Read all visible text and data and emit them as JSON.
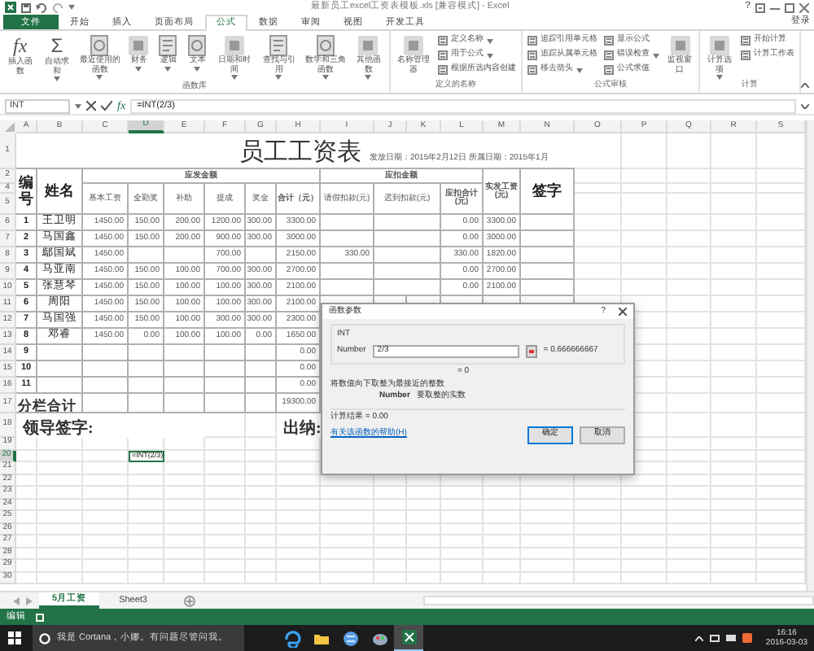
{
  "window": {
    "title": "最新员工excel工资表模板.xls  [兼容模式] - Excel",
    "help": "?"
  },
  "ribbon_tabs": [
    {
      "label": "文件",
      "kind": "file",
      "selected": false
    },
    {
      "label": "开始",
      "kind": "tab",
      "selected": false
    },
    {
      "label": "插入",
      "kind": "tab",
      "selected": false
    },
    {
      "label": "页面布局",
      "kind": "tab",
      "selected": false
    },
    {
      "label": "公式",
      "kind": "tab",
      "selected": true
    },
    {
      "label": "数据",
      "kind": "tab",
      "selected": false
    },
    {
      "label": "审阅",
      "kind": "tab",
      "selected": false
    },
    {
      "label": "视图",
      "kind": "tab",
      "selected": false
    },
    {
      "label": "开发工具",
      "kind": "tab",
      "selected": false
    }
  ],
  "account": "登录",
  "ribbon_groups": [
    {
      "label": "函数库",
      "items": [
        {
          "kind": "large",
          "symbol": "fx",
          "label": "插入函数",
          "dropdown": false
        },
        {
          "kind": "large",
          "symbol": "Σ",
          "label": "自动求和",
          "dropdown": true
        },
        {
          "kind": "large",
          "label": "最近使用的函数",
          "dropdown": true
        },
        {
          "kind": "large",
          "label": "财务",
          "dropdown": true
        },
        {
          "kind": "large",
          "label": "逻辑",
          "dropdown": true
        },
        {
          "kind": "large",
          "label": "文本",
          "dropdown": true
        },
        {
          "kind": "large",
          "label": "日期和时间",
          "dropdown": true
        },
        {
          "kind": "large",
          "label": "查找与引用",
          "dropdown": true
        },
        {
          "kind": "large",
          "label": "数学和三角函数",
          "dropdown": true
        },
        {
          "kind": "large",
          "label": "其他函数",
          "dropdown": true
        }
      ]
    },
    {
      "label": "定义的名称",
      "items": [
        {
          "kind": "large",
          "label": "名称管理器",
          "dropdown": false
        },
        {
          "kind": "small",
          "label": "定义名称",
          "dropdown": true
        },
        {
          "kind": "small",
          "label": "用于公式",
          "dropdown": true
        },
        {
          "kind": "small",
          "label": "根据所选内容创建",
          "dropdown": false
        }
      ]
    },
    {
      "label": "公式审核",
      "items": [
        {
          "kind": "small",
          "label": "追踪引用单元格",
          "dropdown": false
        },
        {
          "kind": "small",
          "label": "追踪从属单元格",
          "dropdown": false
        },
        {
          "kind": "small",
          "label": "移去箭头",
          "dropdown": true
        },
        {
          "kind": "small",
          "label": "显示公式",
          "dropdown": false
        },
        {
          "kind": "small",
          "label": "错误检查",
          "dropdown": true
        },
        {
          "kind": "small",
          "label": "公式求值",
          "dropdown": false
        },
        {
          "kind": "large",
          "label": "监视窗口",
          "dropdown": false
        }
      ]
    },
    {
      "label": "计算",
      "items": [
        {
          "kind": "large",
          "label": "计算选项",
          "dropdown": true
        },
        {
          "kind": "small",
          "label": "开始计算",
          "dropdown": false
        },
        {
          "kind": "small",
          "label": "计算工作表",
          "dropdown": false
        }
      ]
    }
  ],
  "formula_bar": {
    "name_box": "INT",
    "fx": "fx",
    "formula": "=INT(2/3)"
  },
  "columns": [
    {
      "label": "A",
      "selected": false
    },
    {
      "label": "B",
      "selected": false
    },
    {
      "label": "C",
      "selected": false
    },
    {
      "label": "D",
      "selected": true
    },
    {
      "label": "E",
      "selected": false
    },
    {
      "label": "F",
      "selected": false
    },
    {
      "label": "G",
      "selected": false
    },
    {
      "label": "H",
      "selected": false
    },
    {
      "label": "I",
      "selected": false
    },
    {
      "label": "J",
      "selected": false
    },
    {
      "label": "K",
      "selected": false
    },
    {
      "label": "L",
      "selected": false
    },
    {
      "label": "M",
      "selected": false
    },
    {
      "label": "N",
      "selected": false
    },
    {
      "label": "O",
      "selected": false
    },
    {
      "label": "P",
      "selected": false
    },
    {
      "label": "Q",
      "selected": false
    },
    {
      "label": "R",
      "selected": false
    },
    {
      "label": "S",
      "selected": false
    }
  ],
  "rows": [
    {
      "label": "1",
      "selected": false
    },
    {
      "label": "2",
      "selected": false
    },
    {
      "label": "4",
      "selected": false
    },
    {
      "label": "5",
      "selected": false
    },
    {
      "label": "6",
      "selected": false
    },
    {
      "label": "7",
      "selected": false
    },
    {
      "label": "8",
      "selected": false
    },
    {
      "label": "9",
      "selected": false
    },
    {
      "label": "10",
      "selected": false
    },
    {
      "label": "11",
      "selected": false
    },
    {
      "label": "12",
      "selected": false
    },
    {
      "label": "13",
      "selected": false
    },
    {
      "label": "14",
      "selected": false
    },
    {
      "label": "15",
      "selected": false
    },
    {
      "label": "16",
      "selected": false
    },
    {
      "label": "17",
      "selected": false
    },
    {
      "label": "18",
      "selected": false
    },
    {
      "label": "19",
      "selected": false
    },
    {
      "label": "20",
      "selected": true
    },
    {
      "label": "21",
      "selected": false
    },
    {
      "label": "22",
      "selected": false
    },
    {
      "label": "23",
      "selected": false
    },
    {
      "label": "24",
      "selected": false
    },
    {
      "label": "25",
      "selected": false
    },
    {
      "label": "26",
      "selected": false
    },
    {
      "label": "27",
      "selected": false
    },
    {
      "label": "28",
      "selected": false
    },
    {
      "label": "29",
      "selected": false
    },
    {
      "label": "30",
      "selected": false
    }
  ],
  "sheet": {
    "title": "员工工资表",
    "date_line": "发放日期：2015年2月12日 所属日期：2015年1月",
    "headers": {
      "number": "编号",
      "name": "姓名",
      "earnings_group": "应发金额",
      "deductions_group": "应扣金额",
      "earnings": [
        "基本工资",
        "全勤奖",
        "补助",
        "提成",
        "奖金",
        "合计（元）"
      ],
      "deductions": [
        "请假扣款(元)",
        "迟到扣款(元)",
        "应扣合计(元)"
      ],
      "net_pay": "实发工资(元)",
      "signature": "签字"
    },
    "records": [
      {
        "number": "1",
        "name": "王卫明",
        "values": {
          "basic": "1450.00",
          "attendance": "150.00",
          "allowance": "200.00",
          "commission": "1200.00",
          "bonus": "300.00",
          "total": "3300.00",
          "deduction_total": "0.00",
          "net": "3300.00"
        }
      },
      {
        "number": "2",
        "name": "马国鑫",
        "values": {
          "basic": "1450.00",
          "attendance": "150.00",
          "allowance": "200.00",
          "commission": "900.00",
          "bonus": "300.00",
          "total": "3000.00",
          "deduction_total": "0.00",
          "net": "3000.00"
        }
      },
      {
        "number": "3",
        "name": "鄢国斌",
        "values": {
          "basic": "1450.00",
          "commission": "700.00",
          "total": "2150.00",
          "leave": "330.00",
          "deduction_total": "330.00",
          "net": "1820.00"
        }
      },
      {
        "number": "4",
        "name": "马亚南",
        "values": {
          "basic": "1450.00",
          "attendance": "150.00",
          "allowance": "100.00",
          "commission": "700.00",
          "bonus": "300.00",
          "total": "2700.00",
          "deduction_total": "0.00",
          "net": "2700.00"
        }
      },
      {
        "number": "5",
        "name": "张慧琴",
        "values": {
          "basic": "1450.00",
          "attendance": "150.00",
          "allowance": "100.00",
          "commission": "100.00",
          "bonus": "300.00",
          "total": "2100.00",
          "deduction_total": "0.00",
          "net": "2100.00"
        }
      },
      {
        "number": "6",
        "name": "周阳",
        "values": {
          "basic": "1450.00",
          "attendance": "150.00",
          "allowance": "100.00",
          "commission": "100.00",
          "bonus": "300.00",
          "total": "2100.00"
        }
      },
      {
        "number": "7",
        "name": "马国强",
        "values": {
          "basic": "1450.00",
          "attendance": "150.00",
          "allowance": "100.00",
          "commission": "300.00",
          "bonus": "300.00",
          "total": "2300.00"
        }
      },
      {
        "number": "8",
        "name": "邓睿",
        "values": {
          "basic": "1450.00",
          "attendance": "0.00",
          "allowance": "100.00",
          "commission": "100.00",
          "bonus": "0.00",
          "total": "1650.00"
        }
      },
      {
        "number": "9",
        "values": {
          "total": "0.00"
        }
      },
      {
        "number": "10",
        "values": {
          "total": "0.00"
        }
      },
      {
        "number": "11",
        "values": {
          "total": "0.00"
        }
      }
    ],
    "subtotal": {
      "label": "分栏合计",
      "total": "19300.00"
    },
    "leader_sign": "领导签字:",
    "cashier": "出纳:",
    "editing_cell": "=INT(2/3)"
  },
  "dialog": {
    "title": "函数参数",
    "help": "?",
    "function": "INT",
    "arg_label": "Number",
    "arg_value": "2/3",
    "arg_result": "= 0.666666667",
    "result": "= 0",
    "description": "将数值向下取整为最接近的整数",
    "arg_description_label": "Number",
    "arg_description": "要取整的实数",
    "formula_result": "计算结果 = 0.00",
    "help_link": "有关该函数的帮助(H)",
    "buttons": [
      {
        "label": "确定",
        "default": true
      },
      {
        "label": "取消",
        "default": false
      }
    ]
  },
  "sheet_tabs": [
    {
      "label": "5月工资",
      "selected": true
    },
    {
      "label": "Sheet3",
      "selected": false
    }
  ],
  "status_bar": {
    "mode": "编辑"
  },
  "taskbar": {
    "search": "我是 Cortana，小娜。有问题尽管问我。",
    "apps": [
      {
        "kind": "edge",
        "active": false
      },
      {
        "kind": "folder",
        "active": false
      },
      {
        "kind": "globe",
        "active": false
      },
      {
        "kind": "paint",
        "active": false
      },
      {
        "kind": "excel",
        "active": true
      }
    ],
    "time": "16:16",
    "date": "2016-03-03"
  }
}
